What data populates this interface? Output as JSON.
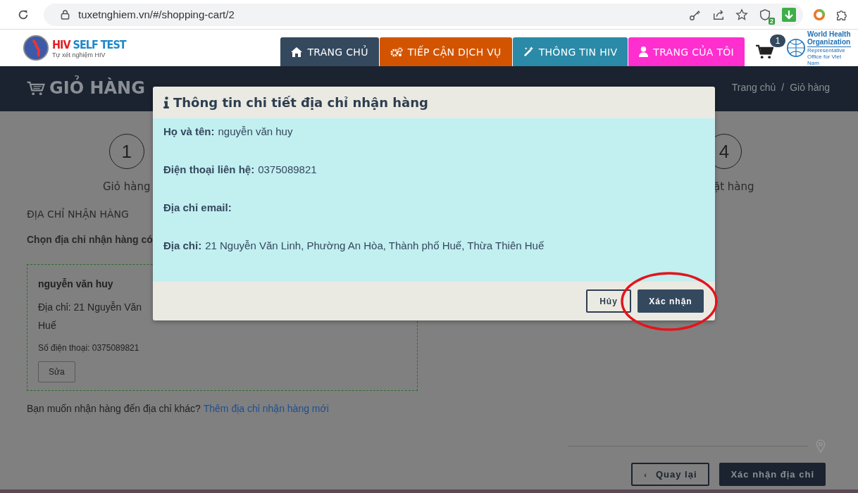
{
  "browser": {
    "url": "tuxetnghiem.vn/#/shopping-cart/2",
    "extension_badge": "2"
  },
  "site": {
    "logo_title_a": "HIV",
    "logo_title_b": "SELF TEST",
    "logo_subtitle": "Tự xét nghiệm HIV",
    "cart_count": "1",
    "partner_name": "World Health Organization",
    "partner_sub": "Representative Office for Viet Nam"
  },
  "nav": [
    {
      "label": "TRANG CHỦ",
      "color": "#34495e"
    },
    {
      "label": "TIẾP CẬN DỊCH VỤ",
      "color": "#d35400"
    },
    {
      "label": "THÔNG TIN HIV",
      "color": "#2a8aa8"
    },
    {
      "label": "TRANG CỦA TÔI",
      "color": "#ff2fcf"
    }
  ],
  "banner": {
    "title": "GIỎ HÀNG",
    "breadcrumb": [
      "Trang chủ",
      "Giỏ hàng"
    ],
    "breadcrumb_separator": "/"
  },
  "steps": [
    {
      "number": "1",
      "label": "Giỏ hàng"
    },
    {
      "number": "4",
      "label": "ặt hàng"
    }
  ],
  "address_section": {
    "heading": "ĐỊA CHỈ NHẬN HÀNG",
    "instruction": "Chọn địa chỉ nhận hàng có",
    "card": {
      "name": "nguyễn văn huy",
      "address_line": "Địa chỉ: 21 Nguyễn Văn",
      "address_cont": "Huế",
      "phone": "Số điện thoại: 0375089821",
      "edit_button": "Sửa"
    },
    "other_prompt": "Bạn muốn nhận hàng đến địa chỉ khác?",
    "add_link": "Thêm địa chỉ nhận hàng mới"
  },
  "footer_buttons": {
    "back": "Quay lại",
    "back_icon": "‹",
    "confirm": "Xác nhận địa chỉ"
  },
  "modal": {
    "title": "Thông tin chi tiết địa chỉ nhận hàng",
    "fields": [
      {
        "label": "Họ và tên:",
        "value": "nguyễn văn huy"
      },
      {
        "label": "Điện thoại liên hệ:",
        "value": "0375089821"
      },
      {
        "label": "Địa chỉ email:"
      },
      {
        "label": "Địa chỉ:",
        "value": "21 Nguyễn Văn Linh, Phường An Hòa, Thành phố Huế, Thừa Thiên Huế"
      }
    ],
    "cancel": "Hủy",
    "confirm": "Xác nhận",
    "confirm_highlighted": true
  }
}
